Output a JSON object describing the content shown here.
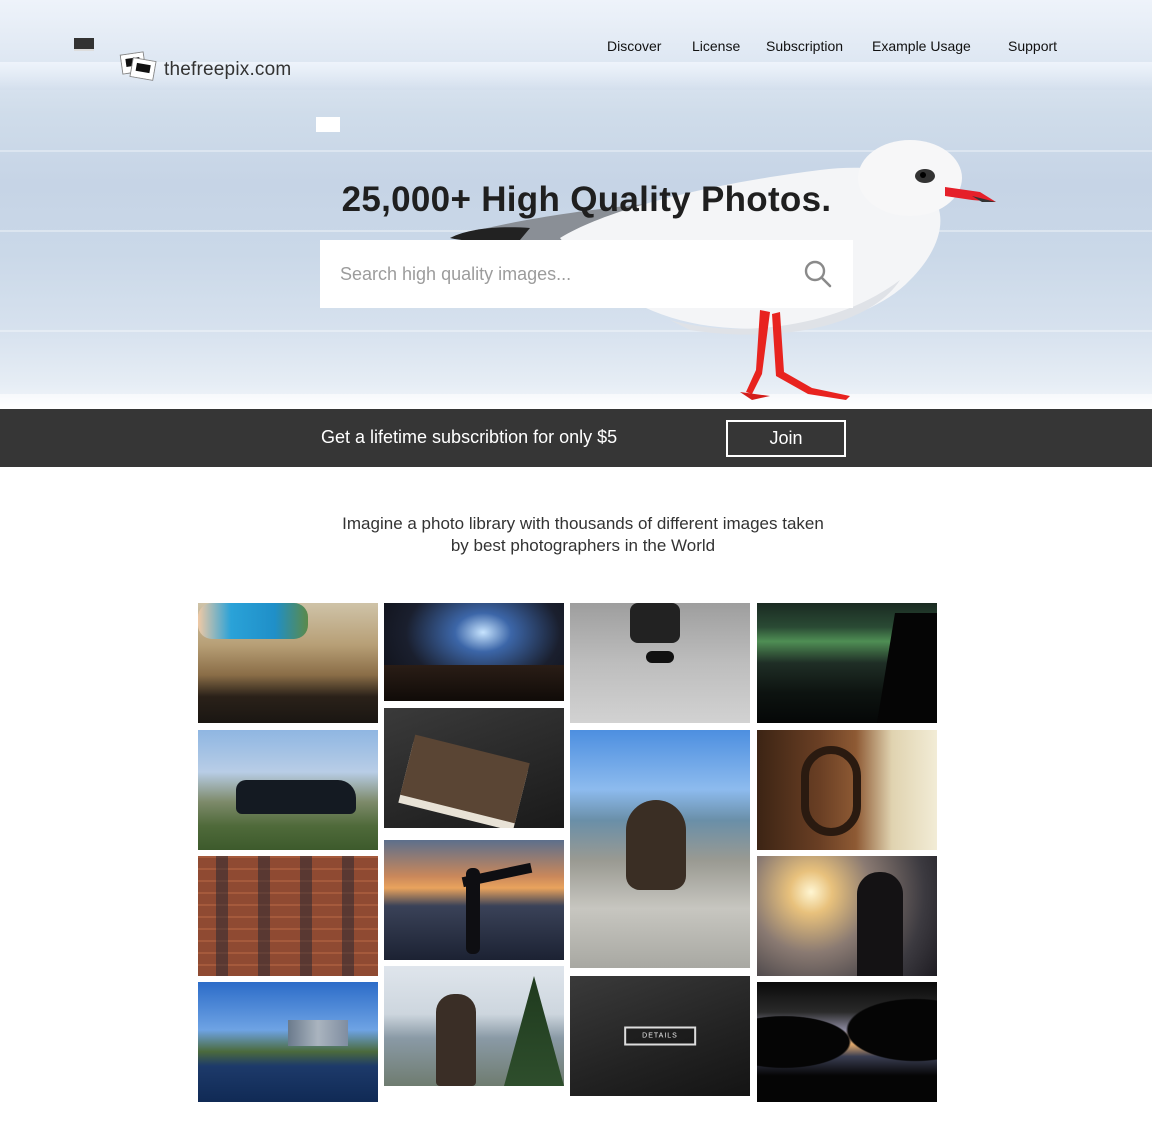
{
  "brand": {
    "name": "thefreepix.com"
  },
  "nav": {
    "items": [
      "Discover",
      "License",
      "Subscription",
      "Example Usage",
      "Support"
    ]
  },
  "hero": {
    "headline": "25,000+ High Quality Photos.",
    "search_placeholder": "Search high quality images..."
  },
  "subscription": {
    "promo": "Get a lifetime subscribtion for only $5",
    "join_label": "Join"
  },
  "intro": {
    "line1": "Imagine a photo library with thousands of different images taken",
    "line2": "by best photographers in the World"
  },
  "gallery": {
    "details_label": "DETAILS",
    "tiles": [
      "boy-on-dock",
      "concert-stage",
      "skateboarder",
      "aurora-night",
      "vintage-car",
      "leather-notebook",
      "seal-on-rocks",
      "wooden-carving",
      "brick-building",
      "yoga-silhouette",
      "man-at-sunset",
      "city-river",
      "woman-by-lake",
      "dark-desk",
      "trees-sunset"
    ]
  },
  "colors": {
    "subbar_bg": "#363636",
    "accent": "#ffffff"
  }
}
